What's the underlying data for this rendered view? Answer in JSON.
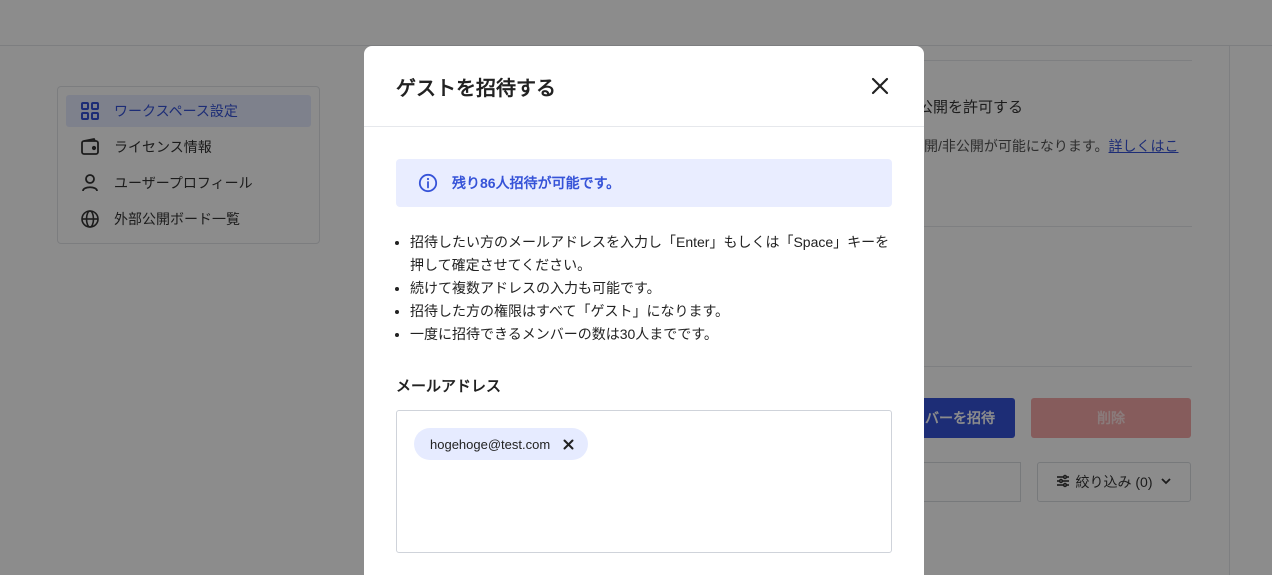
{
  "background": {
    "sidebar": {
      "items": [
        {
          "label": "ワークスペース設定",
          "icon": "grid-icon",
          "active": true
        },
        {
          "label": "ライセンス情報",
          "icon": "wallet-icon",
          "active": false
        },
        {
          "label": "ユーザープロフィール",
          "icon": "user-icon",
          "active": false
        },
        {
          "label": "外部公開ボード一覧",
          "icon": "globe-icon",
          "active": false
        }
      ]
    },
    "settings": {
      "title_fragment": "公開を許可する",
      "desc_fragment": "開/非公開が可能になります。",
      "link_fragment": "詳しくはこ"
    },
    "buttons": {
      "invite_fragment": "バーを招待",
      "delete": "削除",
      "filter": "絞り込み (0)"
    },
    "colors": {
      "accent": "#3653d8",
      "danger_disabled": "#f4a8a8",
      "info_bg": "#e9edff"
    }
  },
  "modal": {
    "title": "ゲストを招待する",
    "info": "残り86人招待が可能です。",
    "notes": [
      "招待したい方のメールアドレスを入力し「Enter」もしくは「Space」キーを押して確定させてください。",
      "続けて複数アドレスの入力も可能です。",
      "招待した方の権限はすべて「ゲスト」になります。",
      "一度に招待できるメンバーの数は30人までです。"
    ],
    "email_label": "メールアドレス",
    "emails": [
      "hogehoge@test.com"
    ]
  }
}
